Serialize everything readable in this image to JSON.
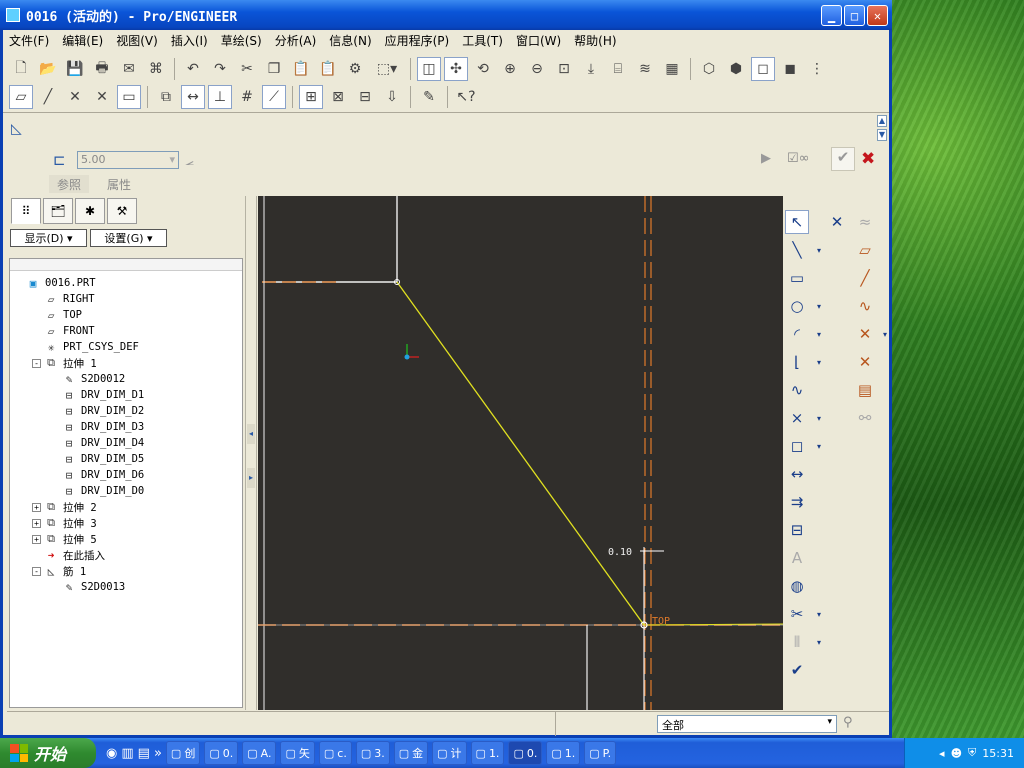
{
  "window": {
    "title": "0016 (活动的) - Pro/ENGINEER"
  },
  "menu": [
    "文件(F)",
    "编辑(E)",
    "视图(V)",
    "插入(I)",
    "草绘(S)",
    "分析(A)",
    "信息(N)",
    "应用程序(P)",
    "工具(T)",
    "窗口(W)",
    "帮助(H)"
  ],
  "dashboard": {
    "thickness_value": "5.00",
    "tabs": [
      "参照",
      "属性"
    ]
  },
  "navigator": {
    "show_label": "显示(D)",
    "settings_label": "设置(G)",
    "tree": [
      {
        "label": "0016.PRT",
        "icon": "part-icon",
        "level": 0,
        "expander": ""
      },
      {
        "label": "RIGHT",
        "icon": "datum-plane-icon",
        "level": 1,
        "expander": ""
      },
      {
        "label": "TOP",
        "icon": "datum-plane-icon",
        "level": 1,
        "expander": ""
      },
      {
        "label": "FRONT",
        "icon": "datum-plane-icon",
        "level": 1,
        "expander": ""
      },
      {
        "label": "PRT_CSYS_DEF",
        "icon": "csys-icon",
        "level": 1,
        "expander": ""
      },
      {
        "label": "拉伸 1",
        "icon": "extrude-icon",
        "level": 1,
        "expander": "-"
      },
      {
        "label": "S2D0012",
        "icon": "sketch-icon",
        "level": 2,
        "expander": ""
      },
      {
        "label": "DRV_DIM_D1",
        "icon": "dimension-icon",
        "level": 2,
        "expander": ""
      },
      {
        "label": "DRV_DIM_D2",
        "icon": "dimension-icon",
        "level": 2,
        "expander": ""
      },
      {
        "label": "DRV_DIM_D3",
        "icon": "dimension-icon",
        "level": 2,
        "expander": ""
      },
      {
        "label": "DRV_DIM_D4",
        "icon": "dimension-icon",
        "level": 2,
        "expander": ""
      },
      {
        "label": "DRV_DIM_D5",
        "icon": "dimension-icon",
        "level": 2,
        "expander": ""
      },
      {
        "label": "DRV_DIM_D6",
        "icon": "dimension-icon",
        "level": 2,
        "expander": ""
      },
      {
        "label": "DRV_DIM_D0",
        "icon": "dimension-icon",
        "level": 2,
        "expander": ""
      },
      {
        "label": "拉伸 2",
        "icon": "extrude-icon",
        "level": 1,
        "expander": "+"
      },
      {
        "label": "拉伸 3",
        "icon": "extrude-icon",
        "level": 1,
        "expander": "+"
      },
      {
        "label": "拉伸 5",
        "icon": "extrude-icon",
        "level": 1,
        "expander": "+"
      },
      {
        "label": "在此插入",
        "icon": "insert-here-arrow-icon",
        "level": 1,
        "expander": ""
      },
      {
        "label": "筋 1",
        "icon": "rib-icon",
        "level": 1,
        "expander": "-"
      },
      {
        "label": "S2D0013",
        "icon": "sketch-icon",
        "level": 2,
        "expander": ""
      }
    ]
  },
  "sketch": {
    "dimension_value": "0.10",
    "plane_label": "TOP"
  },
  "status": {
    "filter_value": "全部"
  },
  "taskbar": {
    "start_label": "开始",
    "items": [
      "创",
      "0.",
      "A.",
      "矢",
      "c.",
      "3.",
      "金",
      "计",
      "1.",
      "0.",
      "1.",
      "P."
    ],
    "clock": "15:31"
  }
}
